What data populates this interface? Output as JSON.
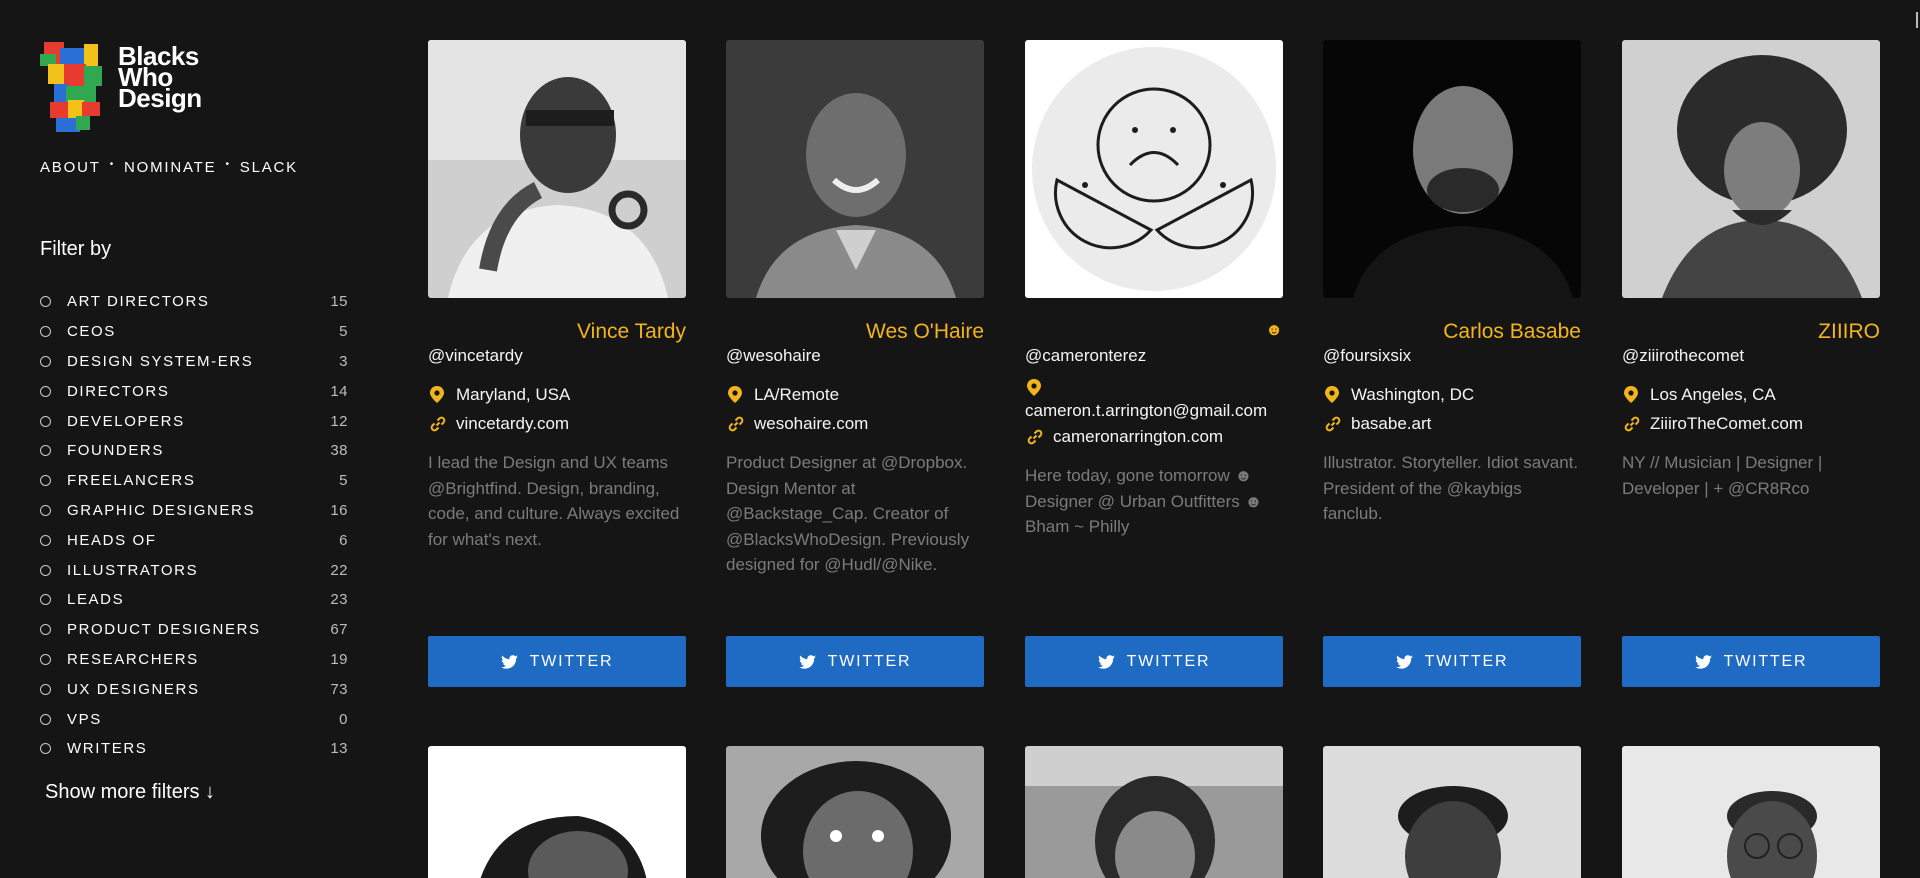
{
  "brand": {
    "line1": "Blacks",
    "line2": "Who",
    "line3": "Design",
    "colors": [
      "#e63b2e",
      "#2a6fd6",
      "#f2c21b",
      "#2fa84f"
    ]
  },
  "nav": {
    "about": "ABOUT",
    "nominate": "NOMINATE",
    "slack": "SLACK",
    "separator": "•"
  },
  "filters": {
    "title": "Filter by",
    "items": [
      {
        "label": "ART DIRECTORS",
        "count": "15"
      },
      {
        "label": "CEOS",
        "count": "5"
      },
      {
        "label": "DESIGN SYSTEM-ERS",
        "count": "3"
      },
      {
        "label": "DIRECTORS",
        "count": "14"
      },
      {
        "label": "DEVELOPERS",
        "count": "12"
      },
      {
        "label": "FOUNDERS",
        "count": "38"
      },
      {
        "label": "FREELANCERS",
        "count": "5"
      },
      {
        "label": "GRAPHIC DESIGNERS",
        "count": "16"
      },
      {
        "label": "HEADS OF",
        "count": "6"
      },
      {
        "label": "ILLUSTRATORS",
        "count": "22"
      },
      {
        "label": "LEADS",
        "count": "23"
      },
      {
        "label": "PRODUCT DESIGNERS",
        "count": "67"
      },
      {
        "label": "RESEARCHERS",
        "count": "19"
      },
      {
        "label": "UX DESIGNERS",
        "count": "73"
      },
      {
        "label": "VPS",
        "count": "0"
      },
      {
        "label": "WRITERS",
        "count": "13"
      }
    ],
    "show_more": "Show more filters ↓"
  },
  "accent": "#f2b41c",
  "button_color": "#1f6bc4",
  "cards": [
    {
      "name": "Vince Tardy",
      "handle": "@vincetardy",
      "location": "Maryland, USA",
      "website": "vincetardy.com",
      "bio": "I lead the Design and UX teams @Brightfind. Design, branding, code, and culture. Always excited for what's next.",
      "button": "TWITTER"
    },
    {
      "name": "Wes O'Haire",
      "handle": "@wesohaire",
      "location": "LA/Remote",
      "website": "wesohaire.com",
      "bio": "Product Designer at @Dropbox. Design Mentor at @Backstage_Cap. Creator of @BlacksWhoDesign. Previously designed for @Hudl/@Nike.",
      "button": "TWITTER"
    },
    {
      "name": "☻",
      "handle": "@cameronterez",
      "location": "cameron.t.arrington@gmail.com",
      "website": "cameronarrington.com",
      "bio": "Here today, gone tomorrow ☻ Designer @ Urban Outfitters ☻ Bham ~ Philly",
      "button": "TWITTER"
    },
    {
      "name": "Carlos Basabe",
      "handle": "@foursixsix",
      "location": "Washington, DC",
      "website": "basabe.art",
      "bio": "Illustrator. Storyteller. Idiot savant. President of the @kaybigs fanclub.",
      "button": "TWITTER"
    },
    {
      "name": "ZIIIRO",
      "handle": "@ziiirothecomet",
      "location": "Los Angeles, CA",
      "website": "ZiiiroTheComet.com",
      "bio": "NY // Musician | Designer | Developer | + @CR8Rco",
      "button": "TWITTER"
    }
  ]
}
